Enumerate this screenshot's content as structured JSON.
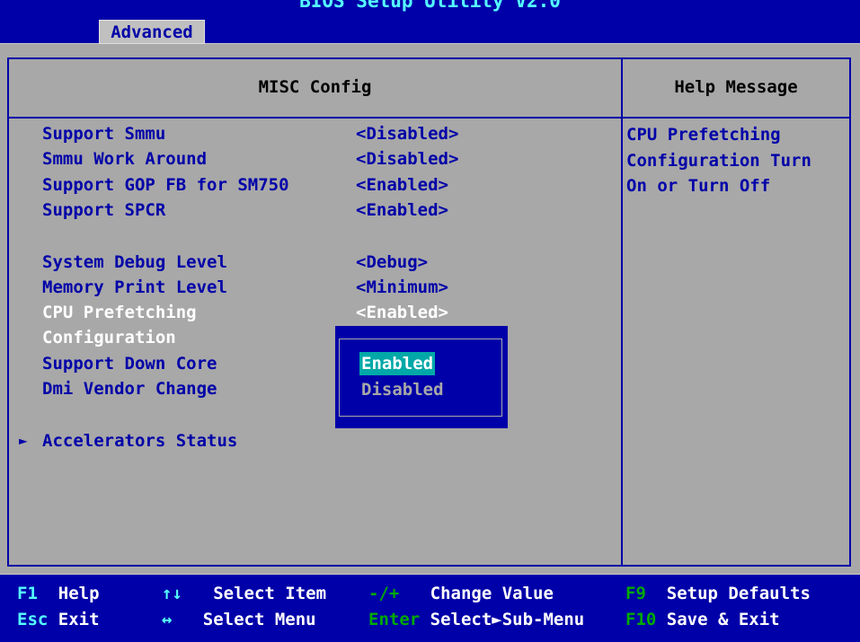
{
  "header": {
    "title": "BIOS Setup Utility V2.0",
    "active_tab": "Advanced"
  },
  "main": {
    "section_title": "MISC Config",
    "items": [
      {
        "label": "Support Smmu",
        "value": "<Disabled>"
      },
      {
        "label": "Smmu Work Around",
        "value": "<Disabled>"
      },
      {
        "label": "Support GOP FB for SM750",
        "value": "<Enabled>"
      },
      {
        "label": "Support SPCR",
        "value": "<Enabled>"
      },
      {
        "label": "System Debug Level",
        "value": "<Debug>"
      },
      {
        "label": "Memory Print Level",
        "value": "<Minimum>"
      },
      {
        "label": "CPU Prefetching",
        "value": "<Enabled>"
      },
      {
        "label": "Configuration",
        "value": ""
      },
      {
        "label": "Support Down Core",
        "value": ""
      },
      {
        "label": "Dmi Vendor Change",
        "value": ""
      }
    ],
    "submenu": {
      "arrow": "►",
      "label": "Accelerators Status"
    }
  },
  "popup": {
    "options": [
      "Enabled",
      "Disabled"
    ],
    "selected": "Enabled"
  },
  "help": {
    "title": "Help Message",
    "lines": [
      "CPU Prefetching",
      "Configuration Turn",
      "On or Turn Off"
    ]
  },
  "footer": {
    "keys": [
      {
        "key": "F1",
        "action": "Help"
      },
      {
        "key": "Esc",
        "action": "Exit"
      },
      {
        "key": "↑↓",
        "action": "Select Item"
      },
      {
        "key": "↔",
        "action": "Select Menu"
      },
      {
        "key": "-/+",
        "action": "Change Value"
      },
      {
        "key": "Enter",
        "action": "Select►Sub-Menu"
      },
      {
        "key": "F9",
        "action": "Setup Defaults"
      },
      {
        "key": "F10",
        "action": "Save & Exit"
      }
    ]
  },
  "colors": {
    "background_blue": "#0000a8",
    "panel_gray": "#a8a8a8",
    "highlight_cyan": "#00a8a8",
    "key_cyan": "#55ffff"
  }
}
